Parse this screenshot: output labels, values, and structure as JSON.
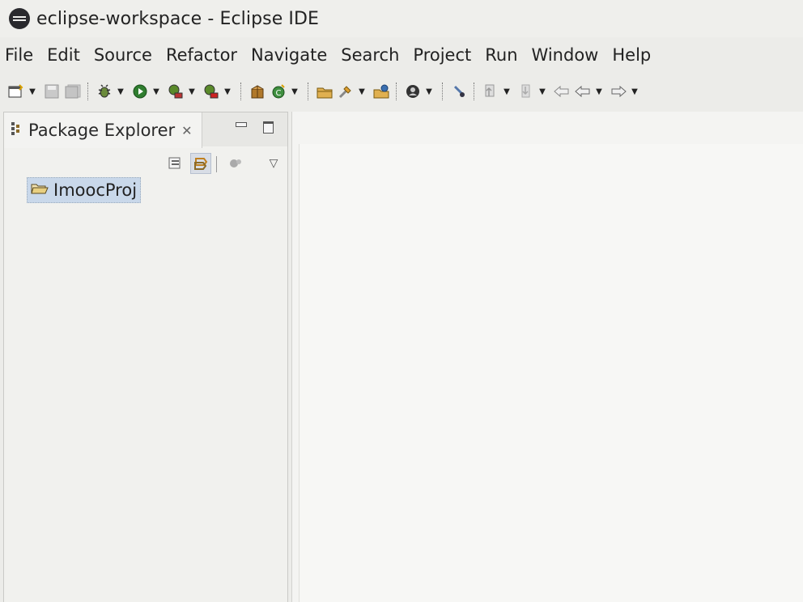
{
  "window": {
    "title": "eclipse-workspace - Eclipse IDE",
    "icon": "eclipse-icon"
  },
  "menu": [
    {
      "label": "File"
    },
    {
      "label": "Edit"
    },
    {
      "label": "Source"
    },
    {
      "label": "Refactor"
    },
    {
      "label": "Navigate"
    },
    {
      "label": "Search"
    },
    {
      "label": "Project"
    },
    {
      "label": "Run"
    },
    {
      "label": "Window"
    },
    {
      "label": "Help"
    }
  ],
  "toolbar": {
    "icons": [
      "new-icon",
      "save-icon",
      "save-all-icon",
      "debug-icon",
      "run-icon",
      "run-last-icon",
      "external-tools-icon",
      "new-package-icon",
      "new-class-icon",
      "open-type-icon",
      "search-icon",
      "open-task-icon",
      "annotation-icon",
      "next-annotation-icon",
      "previous-annotation-icon",
      "back-icon",
      "forward-icon"
    ]
  },
  "package_explorer": {
    "tab_label": "Package Explorer",
    "close_glyph": "✕",
    "tree": [
      {
        "label": "ImoocProj",
        "selected": true
      }
    ]
  },
  "colors": {
    "selection": "#c9d8ea",
    "panel": "#f1f1ee",
    "background": "#ecece9"
  }
}
